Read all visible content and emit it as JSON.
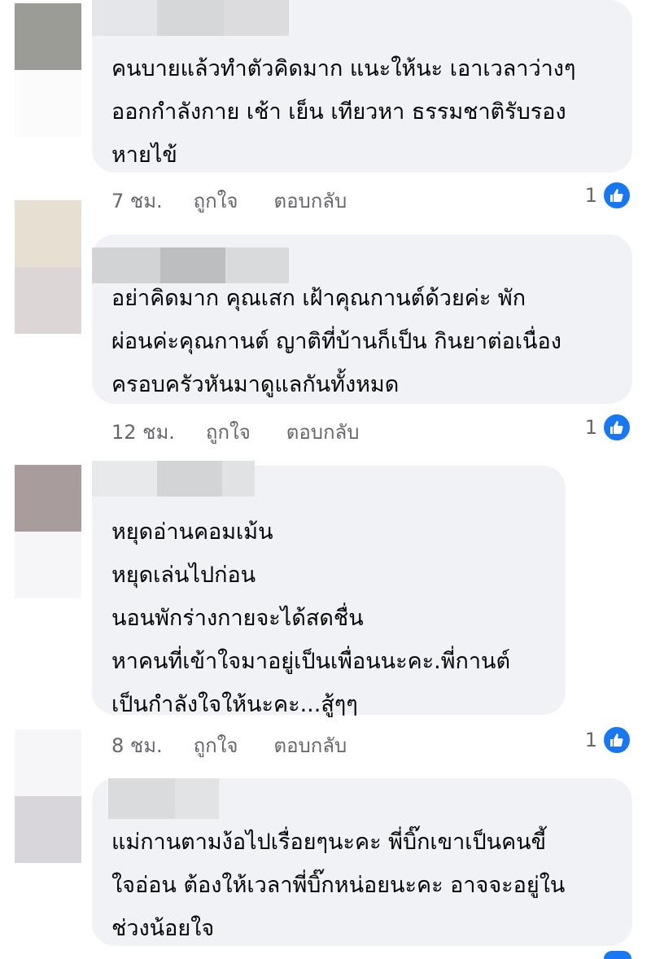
{
  "comments": [
    {
      "text": "คนบายแล้วทำตัวคิดมาก  แนะให้นะ เอาเวลาว่างๆ\nออกกำลังกาย เช้า เย็น เทียวหา ธรรมชาติรับรอง\nหายไข้",
      "time": "7 ชม.",
      "like_label": "ถูกใจ",
      "reply_label": "ตอบกลับ",
      "reaction_count": "1",
      "reaction_icon": "like-icon"
    },
    {
      "text": "อย่าคิดมาก คุณเสก เฝ้าคุณกานต์ด้วยค่ะ พัก\nผ่อนค่ะคุณกานต์ ญาติที่บ้านก็เป็น กินยาต่อเนื่อง\nครอบครัวหันมาดูแลกันทั้งหมด",
      "time": "12 ชม.",
      "like_label": "ถูกใจ",
      "reply_label": "ตอบกลับ",
      "reaction_count": "1",
      "reaction_icon": "like-icon"
    },
    {
      "text": "หยุดอ่านคอมเม้น\nหยุดเล่นไปก่อน\nนอนพักร่างกายจะได้สดชื่น\nหาคนที่เข้าใจมาอยู่เป็นเพื่อนนะคะ.พี่กานต์\nเป็นกำลังใจให้นะคะ...สู้ๆๆ",
      "time": "8 ชม.",
      "like_label": "ถูกใจ",
      "reply_label": "ตอบกลับ",
      "reaction_count": "1",
      "reaction_icon": "like-icon"
    },
    {
      "text": "แม่กานตามง้อไปเรื่อยๆนะคะ พี่บิ๊กเขาเป็นคนขี้\nใจอ่อน ต้องให้เวลาพี่บิ๊กหน่อยนะคะ อาจจะอยู่ใน\nช่วงน้อยใจ"
    }
  ],
  "colors": {
    "bubble": "#f0f2f5",
    "meta_text": "#65676b",
    "like_blue": "#1877f2",
    "avatar_1": [
      "#9c9c96",
      "#ffffff"
    ],
    "avatar_2": [
      "#e6e0d2",
      "#dcd6d6"
    ],
    "avatar_3": [
      "#a89c9c",
      "#f6f6f8"
    ],
    "avatar_4": [
      "#f6f6f8",
      "#d8d6da"
    ]
  }
}
